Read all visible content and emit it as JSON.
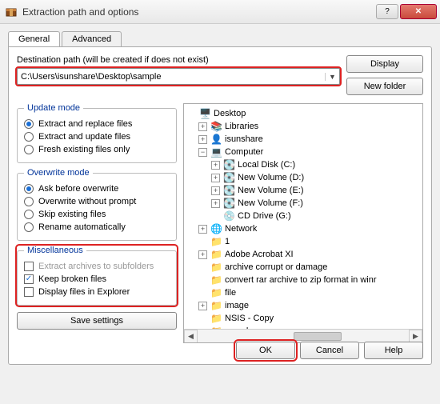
{
  "window": {
    "title": "Extraction path and options"
  },
  "tabs": {
    "general": "General",
    "advanced": "Advanced"
  },
  "dest": {
    "label": "Destination path (will be created if does not exist)",
    "value": "C:\\Users\\isunshare\\Desktop\\sample"
  },
  "buttons": {
    "display": "Display",
    "new_folder": "New folder",
    "save_settings": "Save settings",
    "ok": "OK",
    "cancel": "Cancel",
    "help": "Help"
  },
  "groups": {
    "update": {
      "legend": "Update mode",
      "opt1": "Extract and replace files",
      "opt2": "Extract and update files",
      "opt3": "Fresh existing files only"
    },
    "overwrite": {
      "legend": "Overwrite mode",
      "opt1": "Ask before overwrite",
      "opt2": "Overwrite without prompt",
      "opt3": "Skip existing files",
      "opt4": "Rename automatically"
    },
    "misc": {
      "legend": "Miscellaneous",
      "opt1": "Extract archives to subfolders",
      "opt2": "Keep broken files",
      "opt3": "Display files in Explorer"
    }
  },
  "tree": {
    "desktop": "Desktop",
    "libraries": "Libraries",
    "isunshare": "isunshare",
    "computer": "Computer",
    "local_disk": "Local Disk (C:)",
    "vol_d": "New Volume (D:)",
    "vol_e": "New Volume (E:)",
    "vol_f": "New Volume (F:)",
    "cd": "CD Drive (G:)",
    "network": "Network",
    "one": "1",
    "acrobat": "Adobe Acrobat XI",
    "archive_corrupt": "archive corrupt or damage",
    "convert": "convert rar archive to zip format in winr",
    "file": "file",
    "image": "image",
    "nsis": "NSIS - Copy",
    "sample": "sample"
  }
}
